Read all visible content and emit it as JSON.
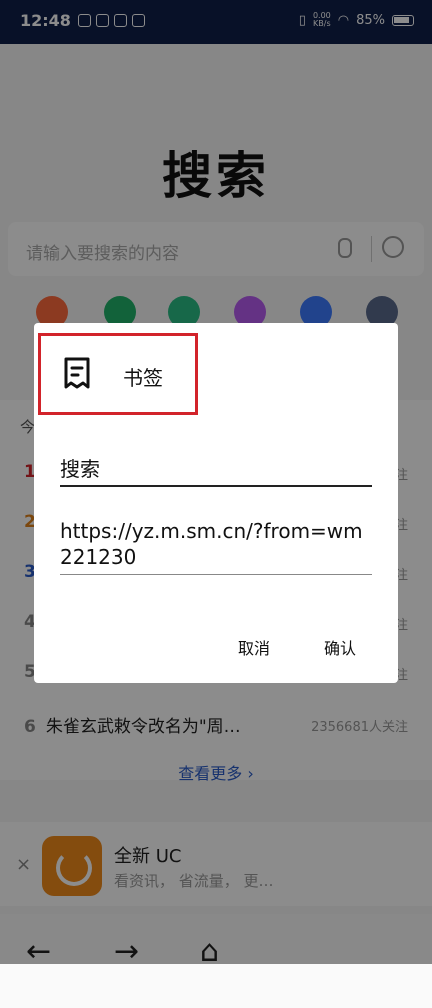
{
  "status_bar": {
    "time": "12:48",
    "net_speed_value": "0.00",
    "net_speed_unit": "KB/s",
    "battery": "85%"
  },
  "page": {
    "title": "搜索",
    "search_placeholder": "请输入要搜索的内容",
    "hot_list": [
      {
        "rank": "1",
        "color": "#d2232a"
      },
      {
        "rank": "2",
        "color": "#e0821b"
      },
      {
        "rank": "3",
        "color": "#2a5cc9"
      },
      {
        "rank": "4",
        "color": "#888888"
      },
      {
        "rank": "5",
        "color": "#888888"
      },
      {
        "rank": "6",
        "text": "朱雀玄武敕令改名为\"周…",
        "follow": "2356681人关注"
      }
    ],
    "section_prefix": "今",
    "follow_suffix": "注",
    "more_label": "查看更多",
    "more_arrow": "›"
  },
  "banner": {
    "close": "×",
    "title": "全新 UC",
    "subtitle": "看资讯， 省流量， 更…"
  },
  "dialog": {
    "title": "书签",
    "name_value": "搜索",
    "url_value": "https://yz.m.sm.cn/?from=wm221230",
    "cancel_label": "取消",
    "confirm_label": "确认",
    "highlight_color": "#d2232a"
  },
  "nav": {
    "back": "←",
    "forward": "→",
    "home": "⌂"
  }
}
